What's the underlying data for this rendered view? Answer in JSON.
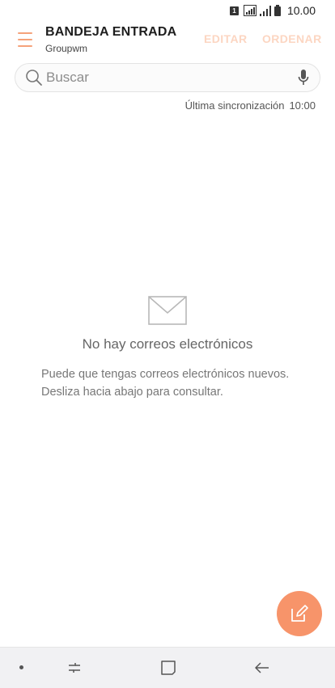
{
  "status_bar": {
    "sim_label": "1",
    "time": "10.00"
  },
  "header": {
    "title": "BANDEJA ENTRADA",
    "account": "Groupwm",
    "edit_label": "EDITAR",
    "sort_label": "ORDENAR"
  },
  "search": {
    "placeholder": "Buscar"
  },
  "sync": {
    "label": "Última sincronización",
    "time": "10:00"
  },
  "empty_state": {
    "title": "No hay correos electrónicos",
    "description": "Puede que tengas correos electrónicos nuevos. Desliza hacia abajo para consultar."
  },
  "colors": {
    "accent": "#f7946a",
    "accent_light": "#fcd6c2",
    "nav_bar": "#f1f1f3"
  },
  "icons": {
    "menu": "hamburger-menu-icon",
    "search": "search-icon",
    "mic": "mic-icon",
    "empty": "envelope-icon",
    "compose": "compose-icon",
    "nav_recent": "recent-apps-icon",
    "nav_home": "home-icon",
    "nav_back": "back-icon"
  }
}
